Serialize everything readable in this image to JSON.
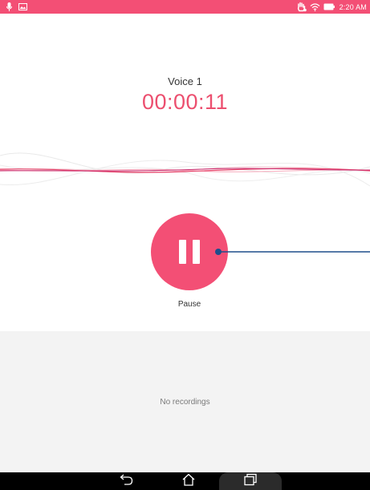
{
  "status_bar": {
    "time": "2:20 AM",
    "icons": [
      "microphone-icon",
      "image-icon",
      "hand-icon",
      "wifi-icon",
      "battery-icon"
    ],
    "background": "#f34f75"
  },
  "recorder": {
    "title": "Voice 1",
    "timer": "00:00:11",
    "pause_label": "Pause",
    "accent_color": "#ec4f6f"
  },
  "recordings": {
    "empty_message": "No recordings"
  },
  "nav_bar": {
    "buttons": [
      "back-icon",
      "home-icon",
      "recents-icon"
    ]
  }
}
